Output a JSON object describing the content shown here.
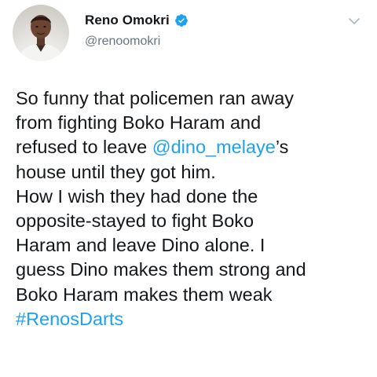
{
  "user": {
    "display_name": "Reno Omokri",
    "handle": "@renoomokri",
    "verified": true
  },
  "tweet": {
    "lines": [
      "So funny that policemen ran away",
      "from fighting Boko Haram and",
      "refused to leave ",
      "@dino_melaye",
      "’s",
      "house until they got him.",
      "How I wish they had done the",
      "opposite-stayed to fight Boko",
      "Haram and leave Dino alone. I",
      "guess Dino makes them strong and",
      "Boko Haram makes them weak",
      "#RenosDarts"
    ]
  },
  "colors": {
    "link": "#1da1f2",
    "text": "#14171a",
    "secondary": "#657786",
    "verified_badge": "#1da1f2"
  },
  "icons": {
    "verified": "verified-badge-icon",
    "menu": "chevron-down-icon"
  }
}
